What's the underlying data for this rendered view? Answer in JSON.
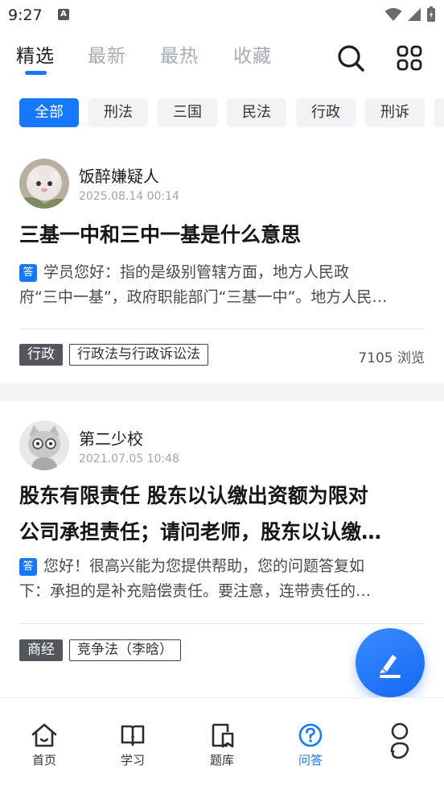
{
  "status": {
    "time": "9:27",
    "notif_letter": "A"
  },
  "tabs": [
    {
      "label": "精选",
      "active": true
    },
    {
      "label": "最新"
    },
    {
      "label": "最热"
    },
    {
      "label": "收藏"
    }
  ],
  "chips": [
    "全部",
    "刑法",
    "三国",
    "民法",
    "行政",
    "刑诉"
  ],
  "posts": [
    {
      "author": "饭醉嫌疑人",
      "date": "2025.08.14  00:14",
      "title": "三基一中和三中一基是什么意思",
      "answer_badge": "答",
      "answer_line1": "学员您好：指的是级别管辖方面，地方人民政",
      "answer_line2": "府“三中一基”，政府职能部门“三基一中”。地方人民…",
      "subject_tag": "行政",
      "course_tag": "行政法与行政诉讼法",
      "views": "7105 浏览"
    },
    {
      "author": "第二少校",
      "date": "2021.07.05  10:48",
      "title_line1": "股东有限责任 股东以认缴出资额为限对",
      "title_line2": "公司承担责任；请问老师，股东以认缴…",
      "answer_badge": "答",
      "answer_line1": "您好！很高兴能为您提供帮助，您的问题答复如",
      "answer_line2": "下：承担的是补充赔偿责任。要注意，连带责任的…",
      "subject_tag": "商经",
      "course_tag": "竞争法（李晗）"
    }
  ],
  "nav": [
    {
      "label": "首页",
      "icon": "home-icon"
    },
    {
      "label": "学习",
      "icon": "book-icon"
    },
    {
      "label": "题库",
      "icon": "question-bank-icon"
    },
    {
      "label": "问答",
      "icon": "help-circle-icon",
      "active": true
    },
    {
      "label": "",
      "icon": "profile-icon"
    }
  ],
  "colors": {
    "accent": "#1677ff",
    "tag_dark": "#53565c"
  }
}
